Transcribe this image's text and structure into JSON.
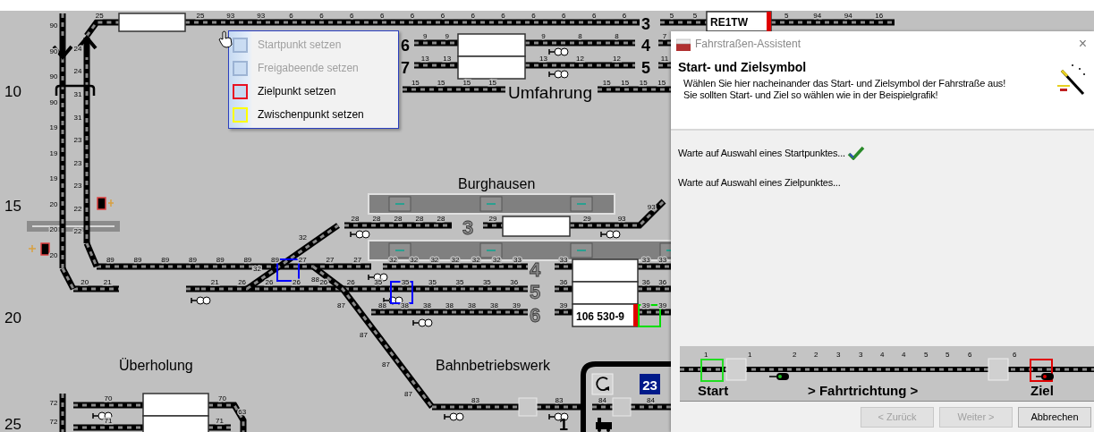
{
  "grid_labels": [
    "10",
    "15",
    "20",
    "25"
  ],
  "station_labels": [
    "Umfahrung",
    "Burghausen",
    "Überholung",
    "Bahnbetriebswerk"
  ],
  "track_names": [
    {
      "label": "3",
      "kind": "main"
    },
    {
      "label": "4",
      "kind": "main"
    },
    {
      "label": "5",
      "kind": "main"
    },
    {
      "label": "6",
      "kind": "main"
    },
    {
      "label": "7",
      "kind": "main"
    },
    {
      "label": "3",
      "kind": "outlined"
    },
    {
      "label": "4",
      "kind": "outlined"
    },
    {
      "label": "5",
      "kind": "outlined"
    },
    {
      "label": "6",
      "kind": "outlined"
    },
    {
      "label": "1",
      "kind": "main"
    }
  ],
  "tracks": [
    {
      "labels": [
        "25"
      ]
    },
    {
      "labels": [
        "25",
        "93",
        "93",
        "6",
        "6",
        "6",
        "6",
        "6",
        "6",
        "6",
        "6",
        "6",
        "6",
        "6",
        "6"
      ]
    },
    {
      "labels": [
        "5",
        "5"
      ]
    },
    {
      "labels": [
        "5",
        "94",
        "94",
        "16"
      ]
    },
    {
      "labels": [
        "9",
        "9"
      ]
    },
    {
      "labels": [
        "9",
        "8",
        "8"
      ]
    },
    {
      "labels": [
        "7"
      ]
    },
    {
      "labels": [
        "13",
        "13"
      ]
    },
    {
      "labels": [
        "13",
        "12",
        "12"
      ]
    },
    {
      "labels": [
        "11"
      ]
    },
    {
      "labels": [
        "15",
        "15",
        "15",
        "15"
      ]
    },
    {
      "labels": [
        "15",
        "15",
        "15",
        "15"
      ]
    },
    {
      "labels": [
        "90",
        "90",
        "90",
        "90",
        "19",
        "19",
        "19",
        "20",
        "20",
        "20"
      ]
    },
    {
      "labels": [
        "20",
        "21"
      ]
    },
    {
      "labels": [
        "24",
        "24",
        "31",
        "31",
        "23",
        "23",
        "23",
        "22",
        "22"
      ]
    },
    {
      "labels": [
        "89",
        "89",
        "89",
        "89",
        "89",
        "89",
        "89",
        "27",
        "27",
        "27"
      ]
    },
    {
      "labels": [
        "32",
        "32",
        "32",
        "32",
        "32",
        "32",
        "33"
      ]
    },
    {
      "labels": [
        "33"
      ]
    },
    {
      "labels": [
        "33",
        "33"
      ]
    },
    {
      "labels": [
        "21",
        "26",
        "26",
        "26",
        "26",
        "26",
        "35",
        "35",
        "35",
        "35",
        "35",
        "36"
      ]
    },
    {
      "labels": [
        "36"
      ]
    },
    {
      "labels": [
        "36",
        "36"
      ]
    },
    {
      "labels": [
        "88",
        "38",
        "38",
        "38",
        "38",
        "38",
        "39"
      ]
    },
    {
      "labels": [
        "39"
      ]
    },
    {
      "labels": [
        "39",
        "39"
      ]
    },
    {
      "labels": [
        "28",
        "28",
        "28",
        "28",
        "28"
      ]
    },
    {
      "labels": [
        "29"
      ]
    },
    {
      "labels": [
        "29",
        "93",
        "93"
      ]
    },
    {
      "labels": [
        "32",
        "32"
      ]
    },
    {
      "labels": [
        "88",
        "87",
        "87",
        "87",
        "87"
      ]
    },
    {
      "labels": [
        "83"
      ]
    },
    {
      "labels": [
        "83"
      ]
    },
    {
      "labels": [
        "72",
        "72"
      ]
    },
    {
      "labels": [
        "70"
      ]
    },
    {
      "labels": [
        "71"
      ]
    },
    {
      "labels": [
        "70",
        "63"
      ]
    },
    {
      "labels": [
        "71"
      ]
    },
    {
      "labels": [
        "84"
      ]
    },
    {
      "labels": [
        "84"
      ]
    }
  ],
  "trains": [
    {
      "label": "RE1TW"
    },
    {
      "label": "106 530-9"
    }
  ],
  "depot_badge": "23",
  "selection_markers": [
    {
      "color": "#0000ff"
    },
    {
      "color": "#0000ff"
    },
    {
      "color": "#00dd00"
    }
  ],
  "context_menu": {
    "items": [
      {
        "label": "Startpunkt setzen",
        "disabled": true,
        "color": "#8fa8cc"
      },
      {
        "label": "Freigabeende setzen",
        "disabled": true,
        "color": "#8fa8cc"
      },
      {
        "label": "Zielpunkt setzen",
        "disabled": false,
        "color": "#e81123"
      },
      {
        "label": "Zwischenpunkt setzen",
        "disabled": false,
        "color": "#ffff00"
      }
    ]
  },
  "dialog": {
    "title": "Fahrstraßen-Assistent",
    "close": "×",
    "heading": "Start- und Zielsymbol",
    "description": [
      "Wählen Sie hier nacheinander das Start- und Zielsymbol der Fahrstraße aus!",
      "Sie sollten Start- und Ziel so wählen wie in der Beispielgrafik!"
    ],
    "steps": [
      {
        "text": "Warte auf Auswahl eines Startpunktes...",
        "done": true
      },
      {
        "text": "Warte auf Auswahl eines Zielpunktes...",
        "done": false
      }
    ],
    "example": {
      "numbers": [
        "1",
        "1",
        "2",
        "2",
        "3",
        "3",
        "4",
        "4",
        "5",
        "5",
        "6",
        "6"
      ],
      "start": "Start",
      "direction": "> Fahrtrichtung >",
      "target": "Ziel"
    },
    "buttons": [
      {
        "label": "< Zurück",
        "disabled": true
      },
      {
        "label": "Weiter >",
        "disabled": true
      },
      {
        "label": "Abbrechen",
        "disabled": false
      }
    ]
  }
}
